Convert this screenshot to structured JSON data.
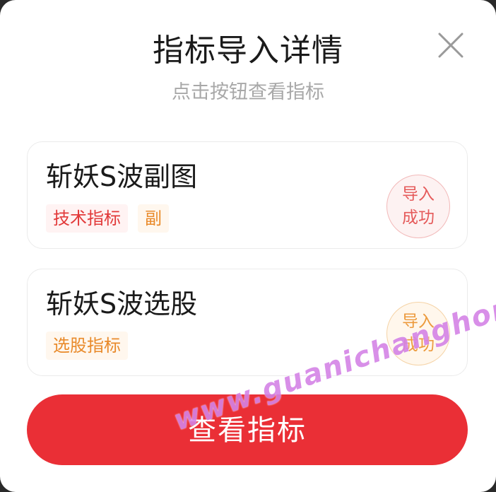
{
  "dialog": {
    "title": "指标导入详情",
    "subtitle": "点击按钮查看指标"
  },
  "cards": [
    {
      "name": "斩妖S波副图",
      "tags": [
        "技术指标",
        "副"
      ],
      "status": [
        "导入",
        "成功"
      ]
    },
    {
      "name": "斩妖S波选股",
      "tags": [
        "选股指标"
      ],
      "status": [
        "导入",
        "成功"
      ]
    }
  ],
  "primary_button": {
    "label": "查看指标"
  },
  "watermark": "www.guanichanghong.com",
  "colors": {
    "primary": "#ea2f36",
    "tag_red": "#e23a3a",
    "tag_orange": "#e98a2a",
    "stamp_red": "#e55a5a",
    "stamp_orange": "#ec9a3c"
  },
  "icons": {
    "close": "close-icon"
  }
}
